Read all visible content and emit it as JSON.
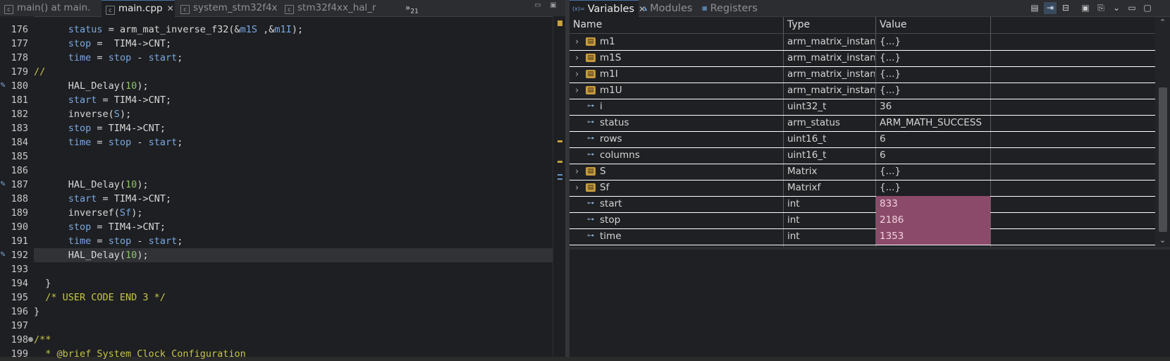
{
  "editor": {
    "tabs": [
      {
        "label": "main() at main.",
        "icon": "debug-file-icon",
        "active": false
      },
      {
        "label": "main.cpp",
        "icon": "cpp-file-icon",
        "active": true
      },
      {
        "label": "system_stm32f4x",
        "icon": "c-file-icon",
        "active": false
      },
      {
        "label": "stm32f4xx_hal_r",
        "icon": "c-file-icon",
        "active": false
      }
    ],
    "overflow_label": "»",
    "overflow_count": "21",
    "lines": [
      {
        "num": "176",
        "code": "      status = arm_mat_inverse_f32(&m1S ,&m1I);"
      },
      {
        "num": "177",
        "code": "      stop =  TIM4->CNT;"
      },
      {
        "num": "178",
        "code": "      time = stop - start;"
      },
      {
        "num": "179",
        "code": "//"
      },
      {
        "num": "180",
        "code": "      HAL_Delay(10);"
      },
      {
        "num": "181",
        "code": "      start = TIM4->CNT;"
      },
      {
        "num": "182",
        "code": "      inverse(S);"
      },
      {
        "num": "183",
        "code": "      stop = TIM4->CNT;"
      },
      {
        "num": "184",
        "code": "      time = stop - start;"
      },
      {
        "num": "185",
        "code": ""
      },
      {
        "num": "186",
        "code": ""
      },
      {
        "num": "187",
        "code": "      HAL_Delay(10);"
      },
      {
        "num": "188",
        "code": "      start = TIM4->CNT;"
      },
      {
        "num": "189",
        "code": "      inversef(Sf);"
      },
      {
        "num": "190",
        "code": "      stop = TIM4->CNT;"
      },
      {
        "num": "191",
        "code": "      time = stop - start;"
      },
      {
        "num": "192",
        "code": "      HAL_Delay(10);"
      },
      {
        "num": "193",
        "code": ""
      },
      {
        "num": "194",
        "code": "  }"
      },
      {
        "num": "195",
        "code": "  /* USER CODE END 3 */"
      },
      {
        "num": "196",
        "code": "}"
      },
      {
        "num": "197",
        "code": ""
      },
      {
        "num": "198",
        "code": "/**"
      },
      {
        "num": "199",
        "code": "  * @brief System Clock Configuration"
      }
    ],
    "current_line": "192",
    "breakpoint_lines": [
      "180",
      "187",
      "192"
    ],
    "fold_lines": [
      "198"
    ]
  },
  "variables_view": {
    "tabs": [
      {
        "label": "Variables",
        "icon": "variables-icon",
        "active": true
      },
      {
        "label": "Modules",
        "icon": "modules-icon",
        "active": false
      },
      {
        "label": "Registers",
        "icon": "registers-icon",
        "active": false
      }
    ],
    "toolbar_icons": [
      "show-type-names-icon",
      "show-logical-structure-icon",
      "collapse-all-icon",
      "add-global-variables-icon",
      "remove-global-variables-icon",
      "view-menu-icon",
      "minimize-icon",
      "maximize-icon"
    ],
    "columns": [
      "Name",
      "Type",
      "Value"
    ],
    "rows": [
      {
        "name": "m1",
        "type": "arm_matrix_instan...",
        "value": "{...}",
        "expandable": true,
        "changed": false
      },
      {
        "name": "m1S",
        "type": "arm_matrix_instan...",
        "value": "{...}",
        "expandable": true,
        "changed": false
      },
      {
        "name": "m1I",
        "type": "arm_matrix_instan...",
        "value": "{...}",
        "expandable": true,
        "changed": false
      },
      {
        "name": "m1U",
        "type": "arm_matrix_instan...",
        "value": "{...}",
        "expandable": true,
        "changed": false
      },
      {
        "name": "i",
        "type": "uint32_t",
        "value": "36",
        "expandable": false,
        "changed": false
      },
      {
        "name": "status",
        "type": "arm_status",
        "value": "ARM_MATH_SUCCESS",
        "expandable": false,
        "changed": false
      },
      {
        "name": "rows",
        "type": "uint16_t",
        "value": "6",
        "expandable": false,
        "changed": false
      },
      {
        "name": "columns",
        "type": "uint16_t",
        "value": "6",
        "expandable": false,
        "changed": false
      },
      {
        "name": "S",
        "type": "Matrix",
        "value": "{...}",
        "expandable": true,
        "changed": false
      },
      {
        "name": "Sf",
        "type": "Matrixf",
        "value": "{...}",
        "expandable": true,
        "changed": false
      },
      {
        "name": "start",
        "type": "int",
        "value": "833",
        "expandable": false,
        "changed": true
      },
      {
        "name": "stop",
        "type": "int",
        "value": "2186",
        "expandable": false,
        "changed": true
      },
      {
        "name": "time",
        "type": "int",
        "value": "1353",
        "expandable": false,
        "changed": true
      }
    ],
    "colors": {
      "changed_value_bg": "#8c4a6a",
      "tab_accent": "#4a6fa5"
    }
  }
}
